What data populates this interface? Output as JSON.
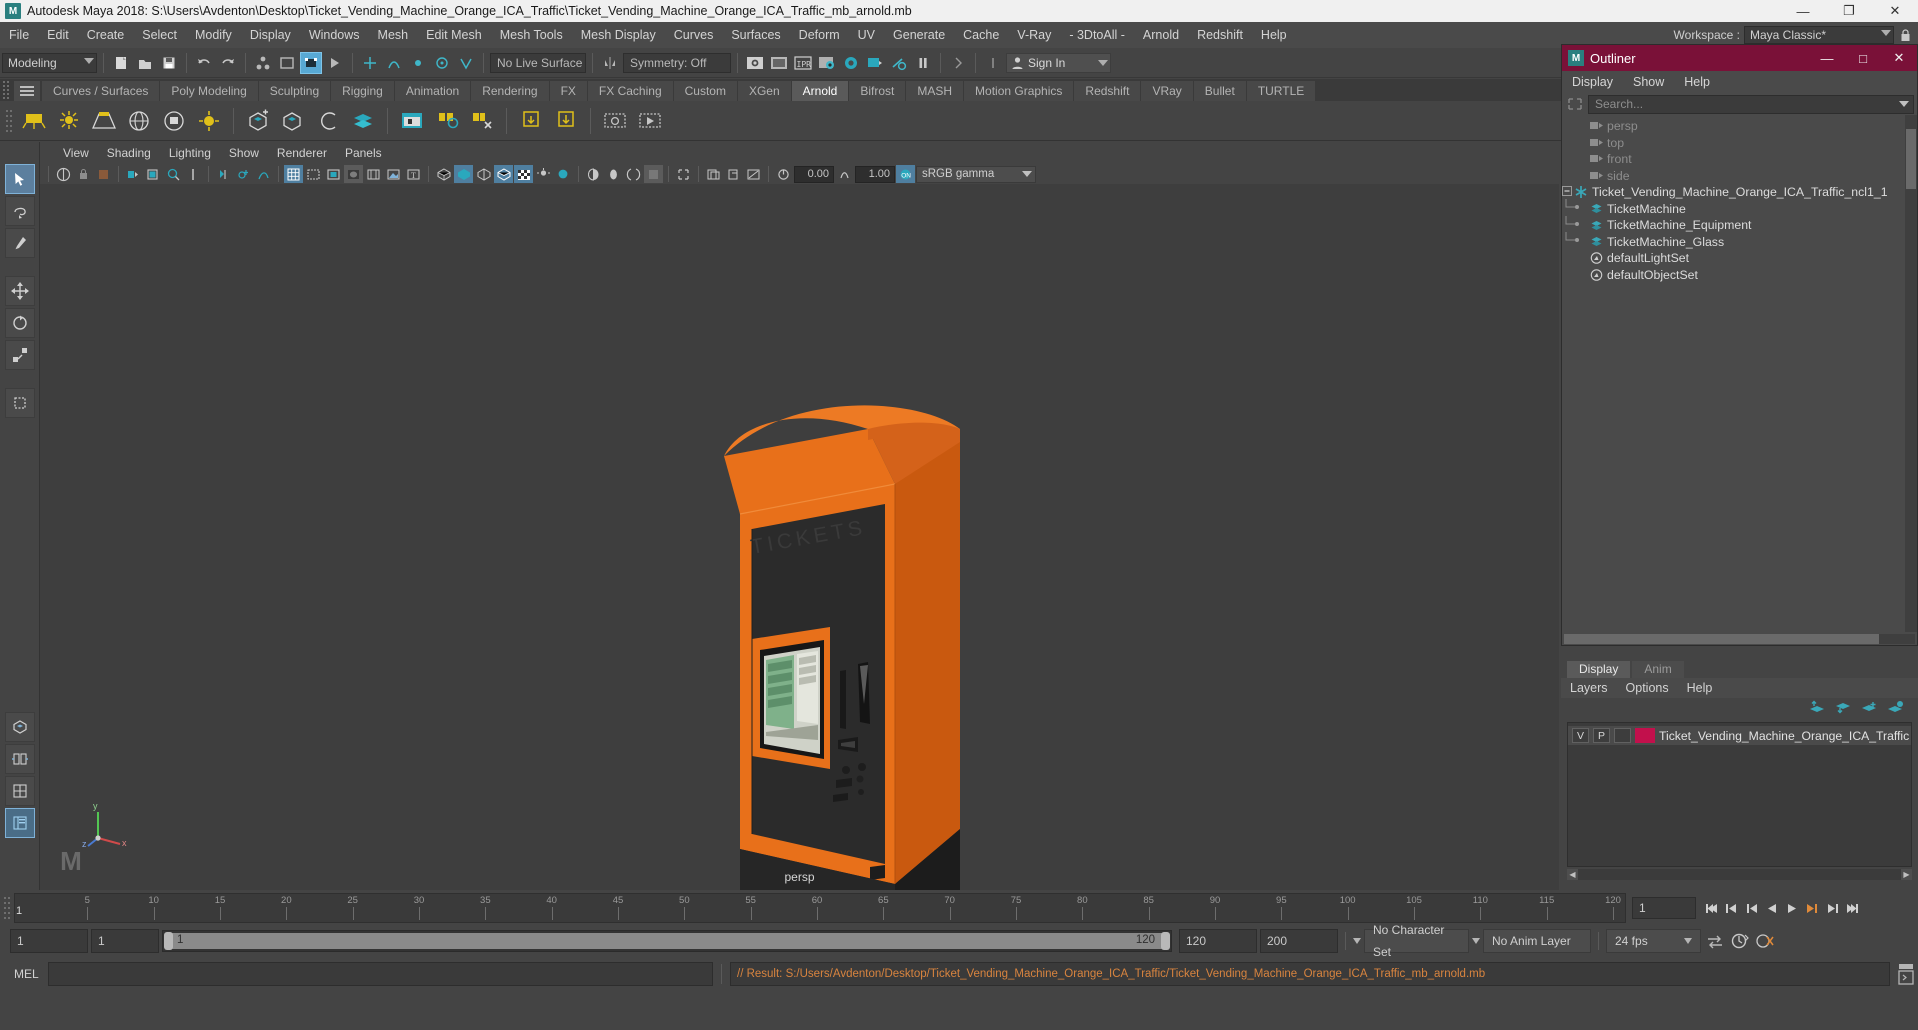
{
  "titlebar": {
    "app_title": "Autodesk Maya 2018: S:\\Users\\Avdenton\\Desktop\\Ticket_Vending_Machine_Orange_ICA_Traffic\\Ticket_Vending_Machine_Orange_ICA_Traffic_mb_arnold.mb",
    "logo": "M",
    "minimize": "—",
    "maximize": "❐",
    "close": "✕"
  },
  "menubar": {
    "items": [
      "File",
      "Edit",
      "Create",
      "Select",
      "Modify",
      "Display",
      "Windows",
      "Mesh",
      "Edit Mesh",
      "Mesh Tools",
      "Mesh Display",
      "Curves",
      "Surfaces",
      "Deform",
      "UV",
      "Generate",
      "Cache",
      "V-Ray",
      "- 3DtoAll -",
      "Arnold",
      "Redshift",
      "Help"
    ],
    "workspace_label": "Workspace :",
    "workspace_value": "Maya Classic*",
    "lock_icon": "lock-icon"
  },
  "statusbar": {
    "mode_value": "Modeling",
    "no_live_surface": "No Live Surface",
    "symmetry": "Symmetry: Off",
    "sign_in": "Sign In"
  },
  "shelf": {
    "tabs": [
      "Curves / Surfaces",
      "Poly Modeling",
      "Sculpting",
      "Rigging",
      "Animation",
      "Rendering",
      "FX",
      "FX Caching",
      "Custom",
      "XGen",
      "Arnold",
      "Bifrost",
      "MASH",
      "Motion Graphics",
      "Redshift",
      "VRay",
      "Bullet",
      "TURTLE"
    ],
    "active_tab": "Arnold"
  },
  "viewport": {
    "panel_menu": [
      "View",
      "Shading",
      "Lighting",
      "Show",
      "Renderer",
      "Panels"
    ],
    "exposure_value": "0.00",
    "gamma_value": "1.00",
    "color_space": "sRGB gamma",
    "camera_label": "persp",
    "axis_x": "x",
    "axis_y": "y",
    "axis_z": "z"
  },
  "outliner": {
    "title": "Outliner",
    "logo": "M",
    "minimize": "—",
    "maximize": "□",
    "close": "✕",
    "menu": [
      "Display",
      "Show",
      "Help"
    ],
    "search_placeholder": "Search...",
    "items": [
      {
        "label": "persp",
        "icon": "camera-icon",
        "indent": 1,
        "dim": true
      },
      {
        "label": "top",
        "icon": "camera-icon",
        "indent": 1,
        "dim": true
      },
      {
        "label": "front",
        "icon": "camera-icon",
        "indent": 1,
        "dim": true
      },
      {
        "label": "side",
        "icon": "camera-icon",
        "indent": 1,
        "dim": true
      },
      {
        "label": "Ticket_Vending_Machine_Orange_ICA_Traffic_ncl1_1",
        "icon": "asterisk-icon",
        "indent": 0,
        "dim": false,
        "expander": "minus"
      },
      {
        "label": "TicketMachine",
        "icon": "mesh-icon",
        "indent": 1,
        "dim": false
      },
      {
        "label": "TicketMachine_Equipment",
        "icon": "mesh-icon",
        "indent": 1,
        "dim": false
      },
      {
        "label": "TicketMachine_Glass",
        "icon": "mesh-icon",
        "indent": 1,
        "dim": false
      },
      {
        "label": "defaultLightSet",
        "icon": "set-icon",
        "indent": 1,
        "dim": false
      },
      {
        "label": "defaultObjectSet",
        "icon": "set-icon",
        "indent": 1,
        "dim": false
      }
    ]
  },
  "layer_editor": {
    "tabs": [
      "Display",
      "Anim"
    ],
    "active_tab": "Display",
    "menu": [
      "Layers",
      "Options",
      "Help"
    ],
    "col_v": "V",
    "col_p": "P",
    "layer_name": "Ticket_Vending_Machine_Orange_ICA_Traffic",
    "layer_color": "#c2104c"
  },
  "timeline": {
    "ticks": [
      "5",
      "10",
      "15",
      "20",
      "25",
      "30",
      "35",
      "40",
      "45",
      "50",
      "55",
      "60",
      "65",
      "70",
      "75",
      "80",
      "85",
      "90",
      "95",
      "100",
      "105",
      "110",
      "115",
      "120"
    ],
    "current_frame_marker": "1",
    "current_frame_field": "1"
  },
  "range": {
    "start": "1",
    "anim_start": "1",
    "range_start": "1",
    "range_end": "120",
    "anim_end": "120",
    "playback_end": "200",
    "character_set": "No Character Set",
    "anim_layer": "No Anim Layer",
    "fps": "24 fps"
  },
  "command": {
    "mel_label": "MEL",
    "input_value": "",
    "output_text": "// Result: S:/Users/Avdenton/Desktop/Ticket_Vending_Machine_Orange_ICA_Traffic/Ticket_Vending_Machine_Orange_ICA_Traffic_mb_arnold.mb"
  },
  "colors": {
    "machine_orange": "#e8701a",
    "machine_dark": "#2b2b2b",
    "accent_teal": "#2a7f7f",
    "outliner_title": "#7a1138"
  }
}
